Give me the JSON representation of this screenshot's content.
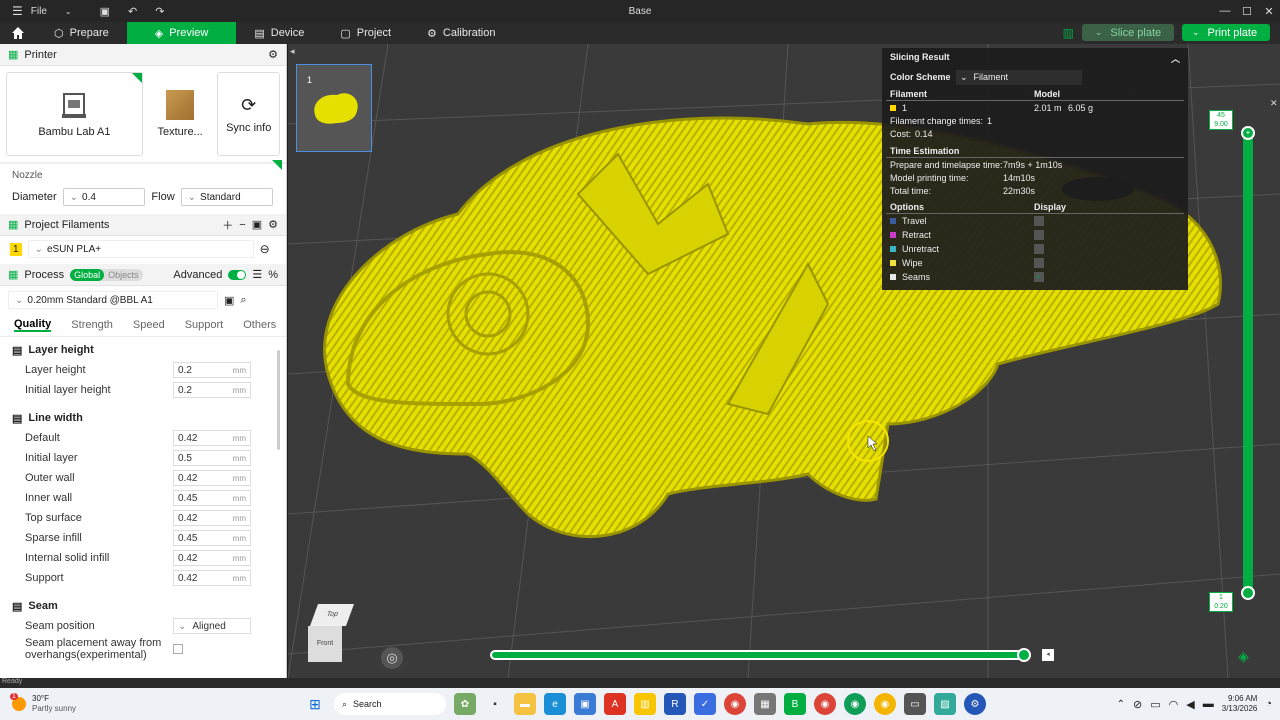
{
  "window": {
    "menu_label": "File",
    "title": "Base"
  },
  "nav": {
    "tabs": [
      {
        "label": "Prepare",
        "icon": "prepare-icon"
      },
      {
        "label": "Preview",
        "icon": "preview-icon"
      },
      {
        "label": "Device",
        "icon": "device-icon"
      },
      {
        "label": "Project",
        "icon": "project-icon"
      },
      {
        "label": "Calibration",
        "icon": "calibration-icon"
      }
    ],
    "slice_label": "Slice plate",
    "print_label": "Print plate"
  },
  "printer": {
    "section_label": "Printer",
    "printer_name": "Bambu Lab A1",
    "plate_label": "Texture...",
    "sync_label": "Sync info",
    "nozzle_label": "Nozzle",
    "diameter_label": "Diameter",
    "diameter_value": "0.4",
    "flow_label": "Flow",
    "flow_value": "Standard"
  },
  "filaments": {
    "section_label": "Project Filaments",
    "items": [
      {
        "index": "1",
        "name": "eSUN PLA+",
        "color": "#ffd800"
      }
    ]
  },
  "process": {
    "section_label": "Process",
    "toggle_global": "Global",
    "toggle_objects": "Objects",
    "advanced_label": "Advanced",
    "preset": "0.20mm Standard @BBL A1",
    "tabs": [
      "Quality",
      "Strength",
      "Speed",
      "Support",
      "Others"
    ],
    "groups": [
      {
        "label": "Layer height",
        "params": [
          {
            "label": "Layer height",
            "value": "0.2",
            "unit": "mm"
          },
          {
            "label": "Initial layer height",
            "value": "0.2",
            "unit": "mm"
          }
        ]
      },
      {
        "label": "Line width",
        "params": [
          {
            "label": "Default",
            "value": "0.42",
            "unit": "mm"
          },
          {
            "label": "Initial layer",
            "value": "0.5",
            "unit": "mm"
          },
          {
            "label": "Outer wall",
            "value": "0.42",
            "unit": "mm"
          },
          {
            "label": "Inner wall",
            "value": "0.45",
            "unit": "mm"
          },
          {
            "label": "Top surface",
            "value": "0.42",
            "unit": "mm"
          },
          {
            "label": "Sparse infill",
            "value": "0.45",
            "unit": "mm"
          },
          {
            "label": "Internal solid infill",
            "value": "0.42",
            "unit": "mm"
          },
          {
            "label": "Support",
            "value": "0.42",
            "unit": "mm"
          }
        ]
      }
    ],
    "seam": {
      "label": "Seam",
      "position_label": "Seam position",
      "position_value": "Aligned",
      "placement_label_1": "Seam placement away from",
      "placement_label_2": "overhangs(experimental)"
    }
  },
  "plate": {
    "number": "1"
  },
  "slicing_result": {
    "title": "Slicing Result",
    "color_scheme_label": "Color Scheme",
    "color_scheme_value": "Filament",
    "col_filament": "Filament",
    "col_model": "Model",
    "filament_index": "1",
    "model_length": "2.01 m",
    "model_weight": "6.05 g",
    "change_times_label": "Filament change times:",
    "change_times_value": "1",
    "cost_label": "Cost:",
    "cost_value": "0.14",
    "time_header": "Time Estimation",
    "prepare_label": "Prepare and timelapse time:",
    "prepare_value": "7m9s + 1m10s",
    "model_time_label": "Model printing time:",
    "model_time_value": "14m10s",
    "total_label": "Total time:",
    "total_value": "22m30s",
    "options_header": "Options",
    "display_header": "Display",
    "options": [
      {
        "label": "Travel",
        "color": "#3a5a9e",
        "checked": false
      },
      {
        "label": "Retract",
        "color": "#c83cc8",
        "checked": false
      },
      {
        "label": "Unretract",
        "color": "#3cb4c8",
        "checked": false
      },
      {
        "label": "Wipe",
        "color": "#f0e040",
        "checked": false
      },
      {
        "label": "Seams",
        "color": "#e8e8e8",
        "checked": true
      }
    ]
  },
  "layer_slider": {
    "top_layer": "45",
    "top_height": "9.00",
    "bottom_layer": "1",
    "bottom_height": "0.20"
  },
  "view_cube": {
    "top": "Top",
    "front": "Front"
  },
  "status": {
    "text": "Ready"
  },
  "taskbar": {
    "weather_temp": "30°F",
    "weather_desc": "Partly sunny",
    "weather_badge": "1",
    "search_placeholder": "Search",
    "time": "9:06 AM",
    "date": "3/13/2026"
  },
  "colors": {
    "accent": "#00ae42",
    "model": "#e6e000"
  }
}
